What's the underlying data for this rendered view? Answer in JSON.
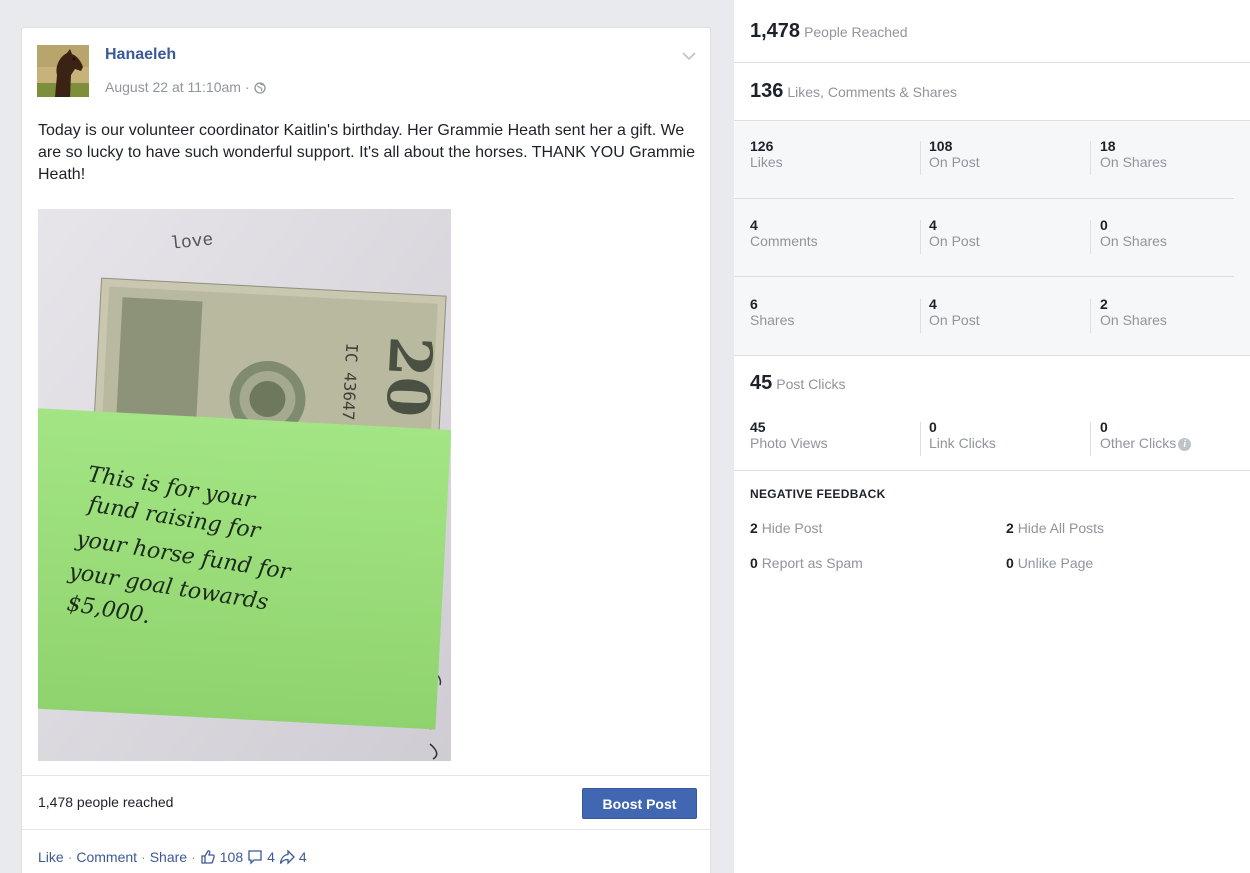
{
  "post": {
    "author": "Hanaeleh",
    "timestamp": "August 22 at 11:10am ·",
    "text": "Today is our volunteer coordinator Kaitlin's birthday. Her Grammie Heath sent her a gift. We are so lucky to have such wonderful support. It's all about the horses. THANK YOU Grammie Heath!",
    "photo": {
      "top_word": "love",
      "bill_serial": "IC 43647",
      "bill_denomination": "20",
      "note_lines": [
        "This is for your",
        "fund raising for",
        "your horse fund for",
        "your goal towards",
        "$5,000."
      ]
    },
    "reach_text": "1,478 people reached",
    "boost_label": "Boost Post",
    "actions": {
      "like": "Like",
      "comment": "Comment",
      "share": "Share",
      "sep": "·",
      "like_count": "108",
      "comment_count": "4",
      "share_count": "4"
    }
  },
  "insights": {
    "reach": {
      "value": "1,478",
      "label": "People Reached"
    },
    "engagement": {
      "value": "136",
      "label": "Likes, Comments & Shares"
    },
    "rows": [
      {
        "cells": [
          {
            "num": "126",
            "lbl": "Likes"
          },
          {
            "num": "108",
            "lbl": "On Post"
          },
          {
            "num": "18",
            "lbl": "On Shares"
          }
        ]
      },
      {
        "cells": [
          {
            "num": "4",
            "lbl": "Comments"
          },
          {
            "num": "4",
            "lbl": "On Post"
          },
          {
            "num": "0",
            "lbl": "On Shares"
          }
        ]
      },
      {
        "cells": [
          {
            "num": "6",
            "lbl": "Shares"
          },
          {
            "num": "4",
            "lbl": "On Post"
          },
          {
            "num": "2",
            "lbl": "On Shares"
          }
        ]
      }
    ],
    "clicks": {
      "value": "45",
      "label": "Post Clicks"
    },
    "click_cells": [
      {
        "num": "45",
        "lbl": "Photo Views"
      },
      {
        "num": "0",
        "lbl": "Link Clicks"
      },
      {
        "num": "0",
        "lbl": "Other Clicks"
      }
    ],
    "info_glyph": "i",
    "negative": {
      "title": "NEGATIVE FEEDBACK",
      "items": [
        {
          "num": "2",
          "lbl": "Hide Post"
        },
        {
          "num": "2",
          "lbl": "Hide All Posts"
        },
        {
          "num": "0",
          "lbl": "Report as Spam"
        },
        {
          "num": "0",
          "lbl": "Unlike Page"
        }
      ]
    }
  },
  "colors": {
    "link": "#3b5998",
    "boost": "#4267b2",
    "note": "#9ae07a",
    "muted": "#90949c"
  },
  "icons": [
    "globe-icon",
    "chevron-down-icon",
    "thumbs-up-icon",
    "comment-icon",
    "share-icon",
    "info-icon"
  ]
}
